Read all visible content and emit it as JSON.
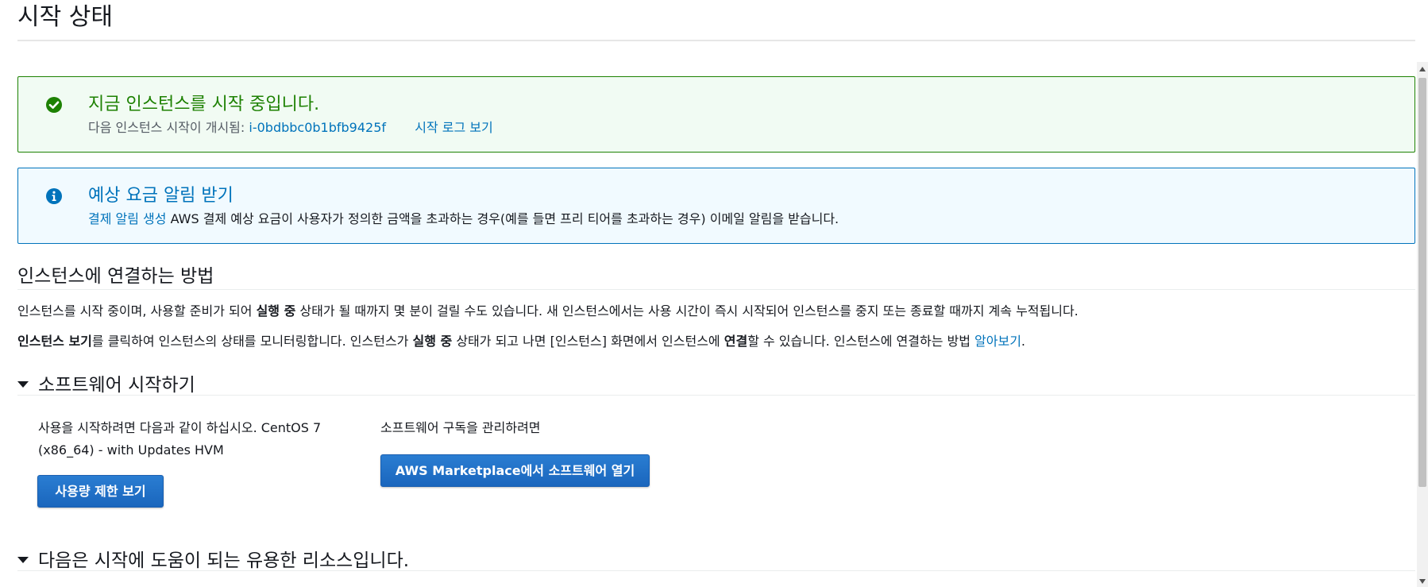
{
  "page": {
    "title": "시작 상태"
  },
  "alerts": {
    "success": {
      "heading": "지금 인스턴스를 시작 중입니다.",
      "text": "다음 인스턴스 시작이 개시됨:",
      "instance_id": "i-0bdbbc0b1bfb9425f",
      "log_link": "시작 로그 보기"
    },
    "info": {
      "heading": "예상 요금 알림 받기",
      "link": "결제 알림 생성",
      "text": "AWS 결제 예상 요금이 사용자가 정의한 금액을 초과하는 경우(예를 들면 프리 티어를 초과하는 경우) 이메일 알림을 받습니다."
    }
  },
  "connect": {
    "heading": "인스턴스에 연결하는 방법",
    "p1": {
      "a": "인스턴스를 시작 중이며, 사용할 준비가 되어 ",
      "b": "실행 중",
      "c": " 상태가 될 때까지 몇 분이 걸릴 수도 있습니다. 새 인스턴스에서는 사용 시간이 즉시 시작되어 인스턴스를 중지 또는 종료할 때까지 계속 누적됩니다."
    },
    "p2": {
      "a": "인스턴스 보기",
      "b": "를 클릭하여 인스턴스의 상태를 모니터링합니다. 인스턴스가 ",
      "c": "실행 중",
      "d": " 상태가 되고 나면 [인스턴스] 화면에서 인스턴스에 ",
      "e": "연결",
      "f": "할 수 있습니다. 인스턴스에 연결하는 방법 ",
      "link": "알아보기",
      "g": "."
    }
  },
  "software": {
    "heading": "소프트웨어 시작하기",
    "left_line1": "사용을 시작하려면 다음과 같이 하십시오. CentOS 7",
    "left_line2": "(x86_64) - with Updates HVM",
    "left_button": "사용량 제한 보기",
    "right_text": "소프트웨어 구독을 관리하려면",
    "right_button": "AWS Marketplace에서 소프트웨어 열기"
  },
  "resources": {
    "heading": "다음은 시작에 도움이 되는 유용한 리소스입니다."
  },
  "colors": {
    "success": "#1d8102",
    "info": "#0073bb",
    "button": "#1a66bd"
  }
}
